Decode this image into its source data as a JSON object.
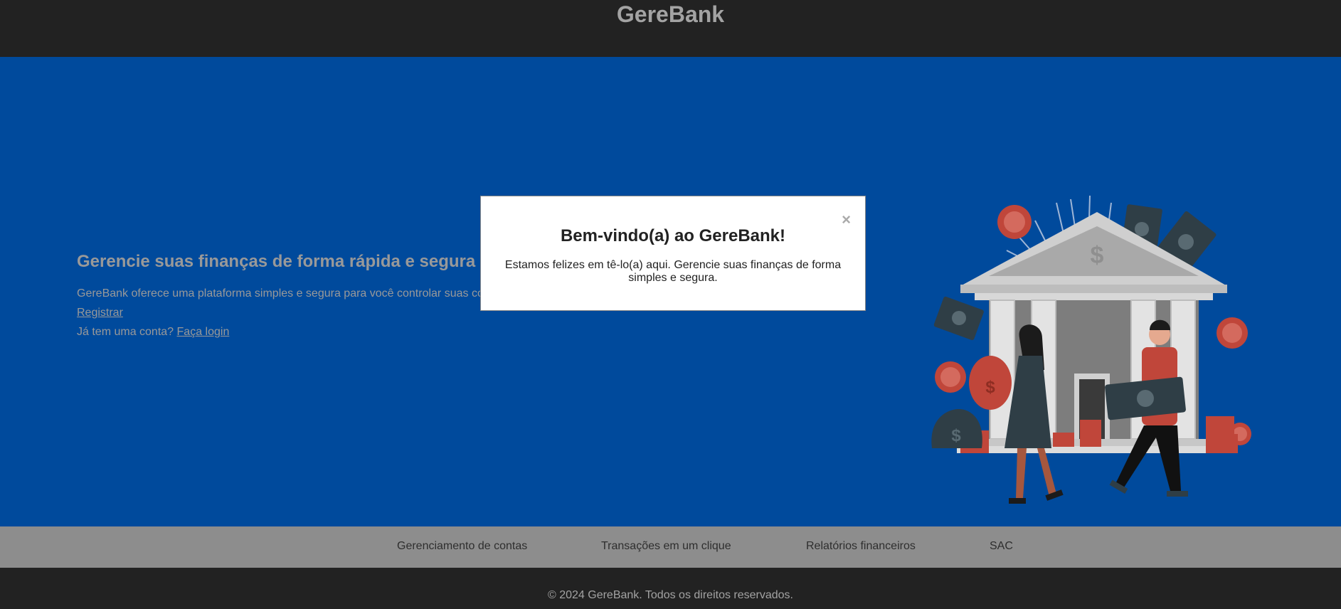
{
  "header": {
    "brand": "GereBank"
  },
  "hero": {
    "title": "Gerencie suas finanças de forma rápida e segura",
    "description": "GereBank oferece uma plataforma simples e segura para você controlar suas co",
    "register_label": "Registrar",
    "login_prompt": "Já tem uma conta?",
    "login_label": "Faça login",
    "illustration_icon": "bank-illustration-icon"
  },
  "modal": {
    "title": "Bem-vindo(a) ao GereBank!",
    "text": "Estamos felizes em tê-lo(a) aqui. Gerencie suas finanças de forma simples e segura.",
    "close_label": "×"
  },
  "footer_nav": {
    "items": [
      {
        "label": "Gerenciamento de contas"
      },
      {
        "label": "Transações em um clique"
      },
      {
        "label": "Relatórios financeiros"
      },
      {
        "label": "SAC"
      }
    ]
  },
  "footer": {
    "copyright": "© 2024 GereBank. Todos os direitos reservados."
  },
  "colors": {
    "header_bg": "#222222",
    "hero_bg": "#004a9c",
    "nav_bg": "#8d8d8d",
    "accent_red": "#c0463a"
  }
}
